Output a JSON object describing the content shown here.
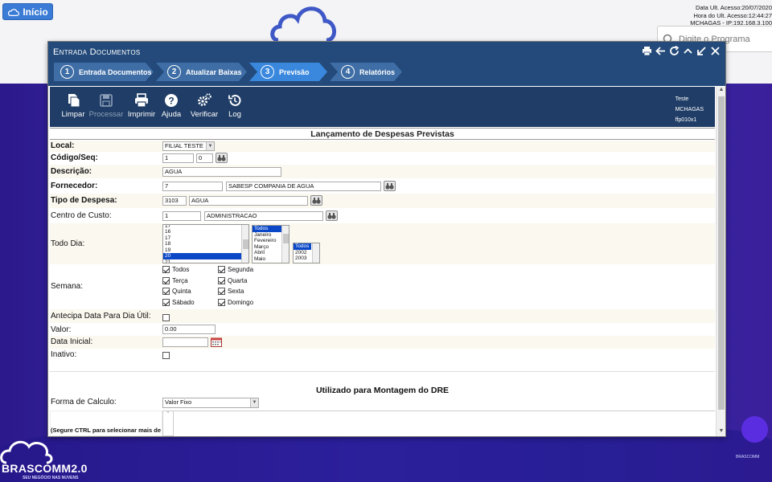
{
  "header": {
    "home_label": "Início",
    "top_brand": "BRASCOMM2.0",
    "session": {
      "line1": "Data Ult. Acesso:20/07/2020",
      "line2": "Hora do Ult. Acesso:12:44:27",
      "line3": "MCHAGAS - IP:192.168.3.100"
    },
    "search_placeholder": "Digite o Programa"
  },
  "window": {
    "title": "Entrada Documentos",
    "controls": [
      "print-icon",
      "back-icon",
      "refresh-icon",
      "collapse-icon",
      "minimize-icon",
      "close-icon"
    ],
    "steps": [
      {
        "num": "1",
        "label": "Entrada Documentos",
        "active": false
      },
      {
        "num": "2",
        "label": "Atualizar Baixas",
        "active": false
      },
      {
        "num": "3",
        "label": "Previsão",
        "active": true
      },
      {
        "num": "4",
        "label": "Relatórios",
        "active": false
      }
    ],
    "toolbar": {
      "limpar": "Limpar",
      "processar": "Processar",
      "imprimir": "Imprimir",
      "ajuda": "Ajuda",
      "verificar": "Verificar",
      "log": "Log",
      "meta1": "Teste",
      "meta2": "MCHAGAS",
      "meta3": "ffp010x1"
    }
  },
  "form": {
    "section_title": "Lançamento de Despesas Previstas",
    "local": {
      "label": "Local:",
      "value": "FILIAL TESTE"
    },
    "codigo": {
      "label": "Código/Seq:",
      "code": "1",
      "seq": "0"
    },
    "descricao": {
      "label": "Descrição:",
      "value": "AGUA"
    },
    "fornecedor": {
      "label": "Fornecedor:",
      "code": "7",
      "name": "SABESP COMPANIA DE AGUA"
    },
    "tipo_despesa": {
      "label": "Tipo de Despesa:",
      "code": "3103",
      "name": "AGUA"
    },
    "centro_custo": {
      "label": "Centro de Custo:",
      "code": "1",
      "name": "ADMINISTRACAO"
    },
    "todo_dia": {
      "label": "Todo Dia:",
      "days": [
        "17",
        "16",
        "17",
        "18",
        "19",
        "20",
        "21"
      ],
      "months": [
        "Todos",
        "Janeiro",
        "Fevereiro",
        "Março",
        "Abril",
        "Maio"
      ],
      "years": [
        "Todos",
        "2002",
        "2003"
      ]
    },
    "semana": {
      "label": "Semana:",
      "days": [
        "Todos",
        "Segunda",
        "Terça",
        "Quarta",
        "Quinta",
        "Sexta",
        "Sábado",
        "Domingo"
      ]
    },
    "antecipa": {
      "label": "Antecipa Data Para Dia Útil:"
    },
    "valor": {
      "label": "Valor:",
      "value": "0.00"
    },
    "data_inicial": {
      "label": "Data Inicial:",
      "value": ""
    },
    "inativo": {
      "label": "Inativo:"
    },
    "dre_title": "Utilizado para Montagem do DRE",
    "forma_calculo": {
      "label": "Forma de Calculo:",
      "value": "Valor Fixo"
    },
    "ctrl_hint": "(Segure CTRL para selecionar mais de"
  },
  "footer": {
    "brand": "BRASCOMM2.0",
    "slogan": "SEU NEGÓCIO NAS NUVENS",
    "mini_brand": "BRASCOMM"
  }
}
